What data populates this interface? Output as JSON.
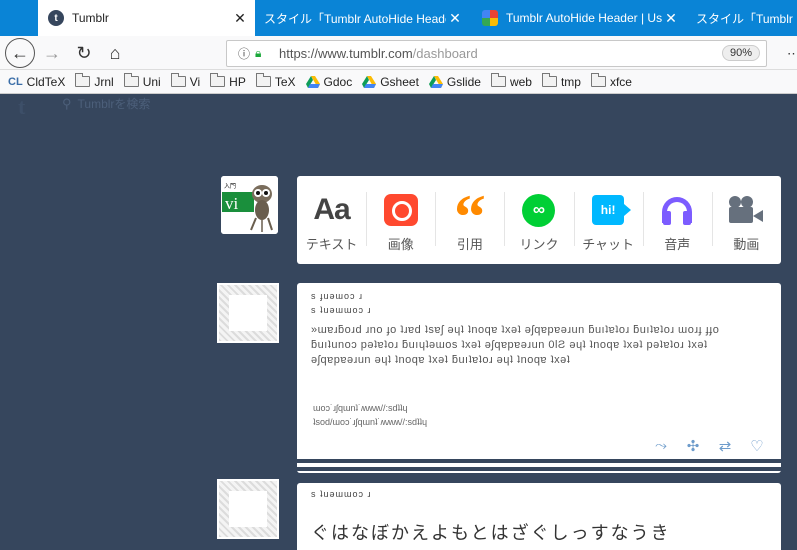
{
  "tabs": [
    {
      "title": "Tumblr",
      "active": true,
      "icon": "tumblr-icon"
    },
    {
      "title": "スタイル「Tumblr AutoHide Header」",
      "active": false,
      "icon": ""
    },
    {
      "title": "Tumblr AutoHide Header | Us",
      "active": false,
      "icon": "multicolor-icon"
    },
    {
      "title": "スタイル「Tumblr Mu",
      "active": false,
      "icon": ""
    }
  ],
  "navbar": {
    "url_host": "https://www.tumblr.com",
    "url_path": "/dashboard",
    "zoom": "90%"
  },
  "bookmarks": [
    {
      "label": "CldTeX",
      "icon": "cl-icon"
    },
    {
      "label": "Jrnl",
      "icon": "folder-icon"
    },
    {
      "label": "Uni",
      "icon": "folder-icon"
    },
    {
      "label": "Vi",
      "icon": "folder-icon"
    },
    {
      "label": "HP",
      "icon": "folder-icon"
    },
    {
      "label": "TeX",
      "icon": "folder-icon"
    },
    {
      "label": "Gdoc",
      "icon": "google-drive-icon"
    },
    {
      "label": "Gsheet",
      "icon": "google-drive-icon"
    },
    {
      "label": "Gslide",
      "icon": "google-drive-icon"
    },
    {
      "label": "web",
      "icon": "folder-icon"
    },
    {
      "label": "tmp",
      "icon": "folder-icon"
    },
    {
      "label": "xfce",
      "icon": "folder-icon"
    }
  ],
  "tumblr": {
    "logo": "t",
    "search_placeholder": "Tumblrを検索"
  },
  "avatar": {
    "badge": "入門",
    "text": "vi"
  },
  "composer": [
    {
      "label": "テキスト",
      "icon": "text-icon",
      "glyph": "Aa",
      "color": "#444444"
    },
    {
      "label": "画像",
      "icon": "camera-icon",
      "glyph": "",
      "color": "#ff492f"
    },
    {
      "label": "引用",
      "icon": "quote-icon",
      "glyph": "“",
      "color": "#ff8a00"
    },
    {
      "label": "リンク",
      "icon": "link-icon",
      "glyph": "∞",
      "color": "#00cf35"
    },
    {
      "label": "チャット",
      "icon": "chat-icon",
      "glyph": "hi!",
      "color": "#00b8ff"
    },
    {
      "label": "音声",
      "icon": "headphones-icon",
      "glyph": "",
      "color": "#7c5cff"
    },
    {
      "label": "動画",
      "icon": "video-camera-icon",
      "glyph": "",
      "color": "#66707d"
    }
  ],
  "post1": {
    "meta1": "s ɟuəɯoɔ ɹ",
    "meta2": "s ʇuəɯɯoɔ ɹ",
    "body": "»ɯɐɹƃoɹd ɹno ɟo ʇɹɐd ʇsɐʃ ǝɥʇ ʇnoqɐ ʇxǝʇ ǝʃqɐpɐǝɹun ƃuıʇɐʇoɹ ƃuıʇɐʇoɹ ɯoɹɟ ɟɟo ƃuıʇunoɔ pǝʇɐʇoɹ ƃuıɥʇǝɯos ʇxǝʇ ǝʃqɐpɐǝɹun 0ƖƧ ǝɥʇ ʇnoqɐ ʇxǝʇ pǝʇɐʇoɹ ʇxǝʇ ǝʃqɐpɐǝɹun ǝɥʇ ʇnoqɐ ʇxǝʇ ƃuıʇɐʇoɹ ǝɥʇ ʇnoqɐ ʇxǝʇ",
    "note1": "ɯoɔ˙ɹʃqɯnʇ˙ʍʍʍ//:sdʇʇɥ",
    "note2": "ʇsod/ɯoɔ˙ɹʃqɯnʇ˙ʍʍʍ//:sdʇʇɥ",
    "actions": [
      "share-icon",
      "reblog-icon",
      "shuffle-icon",
      "like-icon"
    ]
  },
  "post2": {
    "meta": "s ʇuəɯɯoɔ ɹ",
    "body": "ぐはなぼかえよもとはざぐしっすなうき"
  }
}
